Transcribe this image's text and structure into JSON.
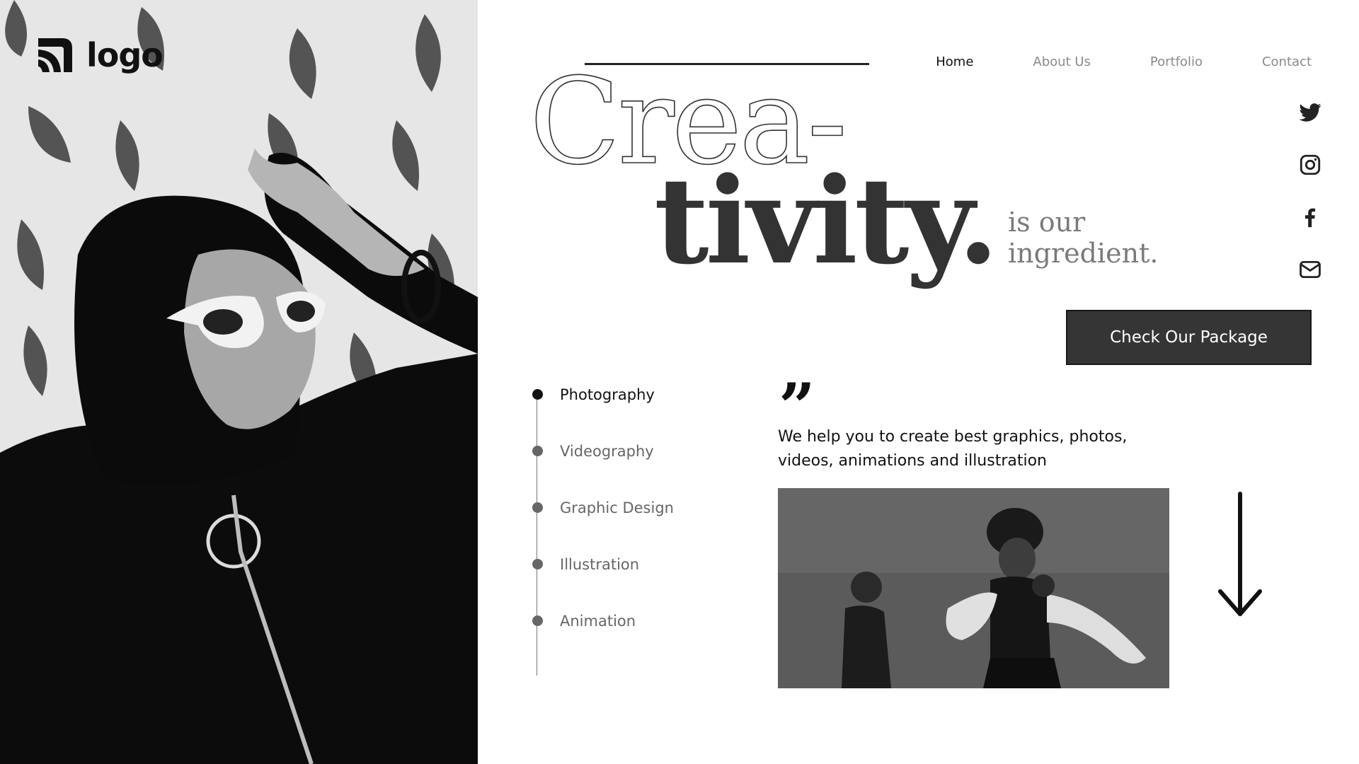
{
  "brand": {
    "logo_text": "logo"
  },
  "nav": {
    "items": [
      {
        "label": "Home",
        "active": true
      },
      {
        "label": "About Us",
        "active": false
      },
      {
        "label": "Portfolio",
        "active": false
      },
      {
        "label": "Contact",
        "active": false
      }
    ]
  },
  "hero": {
    "line1": "Crea-",
    "line2": "tivity.",
    "tagline": "is our ingredient."
  },
  "social": {
    "icons": [
      "twitter-icon",
      "instagram-icon",
      "facebook-icon",
      "mail-icon"
    ]
  },
  "cta": {
    "label": "Check Our Package"
  },
  "services": {
    "items": [
      {
        "label": "Photography",
        "active": true
      },
      {
        "label": "Videography",
        "active": false
      },
      {
        "label": "Graphic Design",
        "active": false
      },
      {
        "label": "Illustration",
        "active": false
      },
      {
        "label": "Animation",
        "active": false
      }
    ]
  },
  "quote": {
    "mark": "”",
    "text": "We help you to create best graphics, photos, videos, animations and illustration"
  },
  "colors": {
    "dark": "#353535",
    "muted": "#8a8a8a",
    "text": "#111111",
    "background": "#ffffff"
  }
}
